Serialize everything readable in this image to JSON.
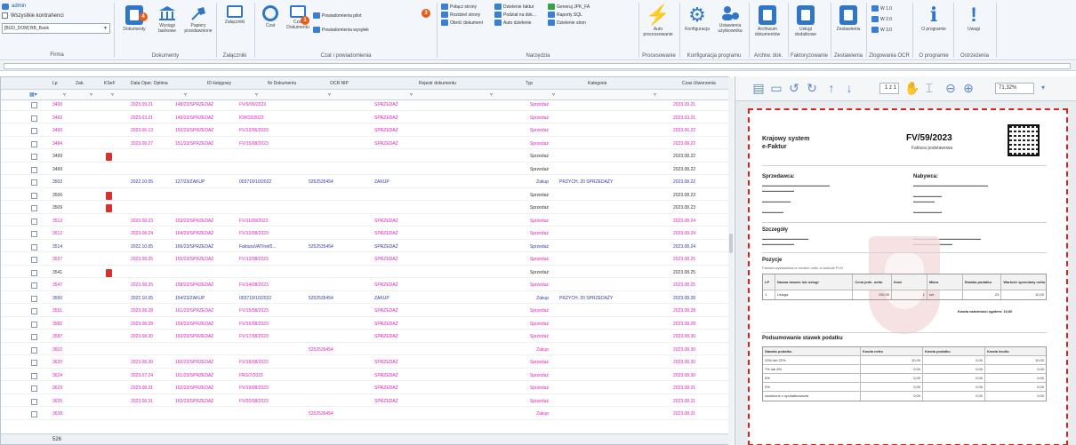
{
  "ribbon": {
    "user": "admin",
    "filter_label": "Wszystkie kontrahenci",
    "firm_value": "[BUD_DOM] BB_Bank",
    "firm_group": "Firma",
    "dokumenty": {
      "label": "Dokumenty",
      "badge": "4",
      "group": "Dokumenty"
    },
    "wyciagi": {
      "label": "Wyciągi bankowe"
    },
    "papiery": {
      "label": "Papiery przedawnione"
    },
    "zalaczniki": {
      "label": "Załączniki",
      "group": "Załączniki"
    },
    "czat": {
      "label": "Czat"
    },
    "czat_dok": {
      "label": "Czat Dokumentu",
      "badge": "1"
    },
    "powiad_left": [
      "Powiadomienia pilot",
      "Powiadomienia wysyłek"
    ],
    "powiad_badge": "3",
    "czat_group": "Czat i powiadomienia",
    "narzedzia_col1": [
      "Połącz strony",
      "Rozdziel strony",
      "Obróć dokument"
    ],
    "narzedzia_col2": [
      "Dzielenie faktur",
      "Podział na dok...",
      "Auto dzielenie"
    ],
    "narzedzia_col3": [
      "Generuj JPK_FA",
      "Raporty SQL",
      "Dzielenie stron"
    ],
    "narzedzia_group": "Narzędzia",
    "auto": {
      "label": "Auto processowanie",
      "group": "Procesowanie"
    },
    "konfig": {
      "label": "Konfiguracja",
      "group": "Konfiguracja programu"
    },
    "uzytkownicy": {
      "label": "Ustawienia użytkownika"
    },
    "archiwum": {
      "label": "Archiwum dokumentów",
      "group": "Archiw. dok."
    },
    "uslugi": {
      "label": "Usługi dodatkowe",
      "group": "Faktoryzowanie"
    },
    "zestawienia": {
      "label": "Zestawienia",
      "group": "Zestawienia"
    },
    "ocr_list": [
      "W 1.0",
      "W 2.0",
      "W 3.0"
    ],
    "ocr_group": "Zlogowania OCR",
    "oprogramie": {
      "label": "O programie",
      "group": "O programie"
    },
    "uwagi": {
      "label": "Uwagi",
      "group": "Ostrzeżenia"
    }
  },
  "grid": {
    "headers": [
      "Lp",
      "Zak.",
      "KSeF",
      "Data Oper. Optima",
      "ID księgowy",
      "Nr Dokumentu",
      "OCR NIP",
      "Rejestr dokumentu",
      "Typ",
      "Kategoria",
      "Czas Utworzenia"
    ],
    "rows": [
      {
        "lp": "3400",
        "data": "2023.09.21",
        "id": "148/23/SPRZEDAŻ",
        "nr": "FV/9/09/2023",
        "nip": "",
        "rej": "SPRZEDAŻ",
        "typ": "Sprzedaż",
        "kat": "",
        "czas": "2023.09.21",
        "color": "pink",
        "ksef": false
      },
      {
        "lp": "3460",
        "data": "2023.03.21",
        "id": "149/23/SPRZEDAŻ",
        "nr": "KW/02/2023",
        "nip": "",
        "rej": "SPRZEDAŻ",
        "typ": "Sprzedaż",
        "kat": "",
        "czas": "2023.03.21",
        "color": "pink",
        "ksef": false
      },
      {
        "lp": "3490",
        "data": "2023.06.13",
        "id": "150/23/SPRZEDAŻ",
        "nr": "FV/12/06/2023",
        "nip": "",
        "rej": "SPRZEDAŻ",
        "typ": "Sprzedaż",
        "kat": "",
        "czas": "2023.06.22",
        "color": "pink",
        "ksef": false
      },
      {
        "lp": "3484",
        "data": "2023.08.27",
        "id": "151/23/SPRZEDAŻ",
        "nr": "FV/15/08/2023",
        "nip": "",
        "rej": "SPRZEDAŻ",
        "typ": "Sprzedaż",
        "kat": "",
        "czas": "2023.08.22",
        "color": "pink",
        "ksef": false
      },
      {
        "lp": "3499",
        "data": "",
        "id": "",
        "nr": "",
        "nip": "",
        "rej": "",
        "typ": "Sprzedaż",
        "kat": "",
        "czas": "2023.08.22",
        "color": "dark",
        "ksef": true
      },
      {
        "lp": "3499",
        "data": "",
        "id": "",
        "nr": "",
        "nip": "",
        "rej": "",
        "typ": "Sprzedaż",
        "kat": "",
        "czas": "2023.08.22",
        "color": "dark",
        "ksef": false
      },
      {
        "lp": "3502",
        "data": "2022.10.05",
        "id": "127/23/ZAKUP",
        "nr": "003719/10/2022",
        "nip": "5252535454",
        "rej": "ZAKUP",
        "typ": "Zakup",
        "kat": "PRZYCH. 20 SPRZEDAŻY",
        "czas": "2023.08.22",
        "color": "blue",
        "ksef": false
      },
      {
        "lp": "3506",
        "data": "",
        "id": "",
        "nr": "",
        "nip": "",
        "rej": "",
        "typ": "Sprzedaż",
        "kat": "",
        "czas": "2023.08.23",
        "color": "dark",
        "ksef": true
      },
      {
        "lp": "3509",
        "data": "",
        "id": "",
        "nr": "",
        "nip": "",
        "rej": "",
        "typ": "Sprzedaż",
        "kat": "",
        "czas": "2023.08.23",
        "color": "dark",
        "ksef": true
      },
      {
        "lp": "3513",
        "data": "2023.08.23",
        "id": "153/23/SPRZEDAŻ",
        "nr": "FV/11/08/2023",
        "nip": "",
        "rej": "SPRZEDAŻ",
        "typ": "Sprzedaż",
        "kat": "",
        "czas": "2023.08.24",
        "color": "pink",
        "ksef": false
      },
      {
        "lp": "3512",
        "data": "2023.08.24",
        "id": "164/23/SPRZEDAŻ",
        "nr": "FV/12/08/2023",
        "nip": "",
        "rej": "SPRZEDAŻ",
        "typ": "Sprzedaż",
        "kat": "",
        "czas": "2023.08.24",
        "color": "pink",
        "ksef": false
      },
      {
        "lp": "3514",
        "data": "2022.10.05",
        "id": "166/23/SPRZEDAŻ",
        "nr": "FakturaVAT/ret/0...",
        "nip": "5252535454",
        "rej": "SPRZEDAŻ",
        "typ": "Sprzedaż",
        "kat": "",
        "czas": "2023.08.24",
        "color": "blue",
        "ksef": false
      },
      {
        "lp": "3537",
        "data": "2023.08.25",
        "id": "155/23/SPRZEDAŻ",
        "nr": "FV/13/08/2023",
        "nip": "",
        "rej": "SPRZEDAŻ",
        "typ": "Sprzedaż",
        "kat": "",
        "czas": "2023.08.25",
        "color": "pink",
        "ksef": false
      },
      {
        "lp": "3541",
        "data": "",
        "id": "",
        "nr": "",
        "nip": "",
        "rej": "",
        "typ": "Sprzedaż",
        "kat": "",
        "czas": "2023.08.25",
        "color": "dark",
        "ksef": true
      },
      {
        "lp": "3547",
        "data": "2023.08.25",
        "id": "158/23/SPRZEDAŻ",
        "nr": "FV/14/08/2023",
        "nip": "",
        "rej": "SPRZEDAŻ",
        "typ": "Sprzedaż",
        "kat": "",
        "czas": "2023.08.25",
        "color": "pink",
        "ksef": false
      },
      {
        "lp": "3550",
        "data": "2022.10.05",
        "id": "154/23/ZAKUP",
        "nr": "003719/10/2022",
        "nip": "5252535454",
        "rej": "ZAKUP",
        "typ": "Zakup",
        "kat": "PRZYCH. 20 SPRZEDAŻY",
        "czas": "2023.08.28",
        "color": "blue",
        "ksef": false
      },
      {
        "lp": "3551",
        "data": "2023.08.28",
        "id": "161/23/SPRZEDAŻ",
        "nr": "FV/15/08/2023",
        "nip": "",
        "rej": "SPRZEDAŻ",
        "typ": "Sprzedaż",
        "kat": "",
        "czas": "2023.08.28",
        "color": "pink",
        "ksef": false
      },
      {
        "lp": "3582",
        "data": "2023.08.28",
        "id": "159/23/SPRZEDAŻ",
        "nr": "FV/16/08/2023",
        "nip": "",
        "rej": "SPRZEDAŻ",
        "typ": "Sprzedaż",
        "kat": "",
        "czas": "2023.08.28",
        "color": "pink",
        "ksef": false
      },
      {
        "lp": "3587",
        "data": "2023.08.30",
        "id": "160/23/SPRZEDAŻ",
        "nr": "FV/17/08/2023",
        "nip": "",
        "rej": "SPRZEDAŻ",
        "typ": "Sprzedaż",
        "kat": "",
        "czas": "2023.08.30",
        "color": "pink",
        "ksef": false
      },
      {
        "lp": "3602",
        "data": "",
        "id": "",
        "nr": "",
        "nip": "5252535454",
        "rej": "",
        "typ": "Zakup",
        "kat": "",
        "czas": "2023.08.30",
        "color": "pink",
        "ksef": false
      },
      {
        "lp": "3620",
        "data": "2023.08.30",
        "id": "160/23/SPRZEDAŻ",
        "nr": "FV/18/08/2023",
        "nip": "",
        "rej": "SPRZEDAŻ",
        "typ": "Sprzedaż",
        "kat": "",
        "czas": "2023.08.30",
        "color": "pink",
        "ksef": false
      },
      {
        "lp": "3624",
        "data": "2023.07.24",
        "id": "161/23/SPRZEDAŻ",
        "nr": "FRS/7/2023",
        "nip": "",
        "rej": "SPRZEDAŻ",
        "typ": "Sprzedaż",
        "kat": "",
        "czas": "2023.08.30",
        "color": "pink",
        "ksef": false
      },
      {
        "lp": "3629",
        "data": "2023.08.31",
        "id": "162/23/SPRZEDAŻ",
        "nr": "FV/19/08/2023",
        "nip": "",
        "rej": "SPRZEDAŻ",
        "typ": "Sprzedaż",
        "kat": "",
        "czas": "2023.08.31",
        "color": "pink",
        "ksef": false
      },
      {
        "lp": "3635",
        "data": "2023.08.31",
        "id": "163/23/SPRZEDAŻ",
        "nr": "FV/20/08/2023",
        "nip": "",
        "rej": "SPRZEDAŻ",
        "typ": "Sprzedaż",
        "kat": "",
        "czas": "2023.08.31",
        "color": "pink",
        "ksef": false
      },
      {
        "lp": "3638",
        "data": "",
        "id": "",
        "nr": "",
        "nip": "5252535454",
        "rej": "",
        "typ": "Zakup",
        "kat": "",
        "czas": "2023.08.31",
        "color": "pink",
        "ksef": false
      }
    ],
    "footer_count": "526"
  },
  "preview": {
    "page": "1 z 1",
    "zoom": "71,32%",
    "invoice": {
      "title_line1": "Krajowy system",
      "title_line2": "e-Faktur",
      "number": "FV/59/2023",
      "subtitle": "Faktura podstawowa",
      "seller_title": "Sprzedawca:",
      "buyer_title": "Nabywca:",
      "details_title": "Szczegóły",
      "positions_title": "Pozycje",
      "positions_caption": "Faktura wystawiona w cenach netto w walucie PLN",
      "item_headers": [
        "LP",
        "Nazwa towaru lub usługi",
        "Cena jedn. netto",
        "Ilość",
        "Miara",
        "Stawka podatku",
        "Wartość sprzedaży netto"
      ],
      "item_row": [
        "1",
        "Usługa",
        "100,00",
        "1",
        "szt.",
        "23",
        "10,00"
      ],
      "total_label": "Kwota należności ogółem: 10,00",
      "vat_title": "Podsumowanie stawek podatku",
      "vat_headers": [
        "Stawka podatku",
        "Kwota netto",
        "Kwota podatku",
        "Kwota brutto"
      ],
      "vat_rows": [
        [
          "23% lub 22%",
          "10,00",
          "0,00",
          "10,00"
        ],
        [
          "7% lub 8%",
          "0,00",
          "0,00",
          "0,00"
        ],
        [
          "5%",
          "0,00",
          "0,00",
          "0,00"
        ],
        [
          "0%",
          "0,00",
          "0,00",
          "0,00"
        ],
        [
          "zwolnione z opodatkowania",
          "0,00",
          "0,00",
          "0,00"
        ]
      ]
    }
  }
}
